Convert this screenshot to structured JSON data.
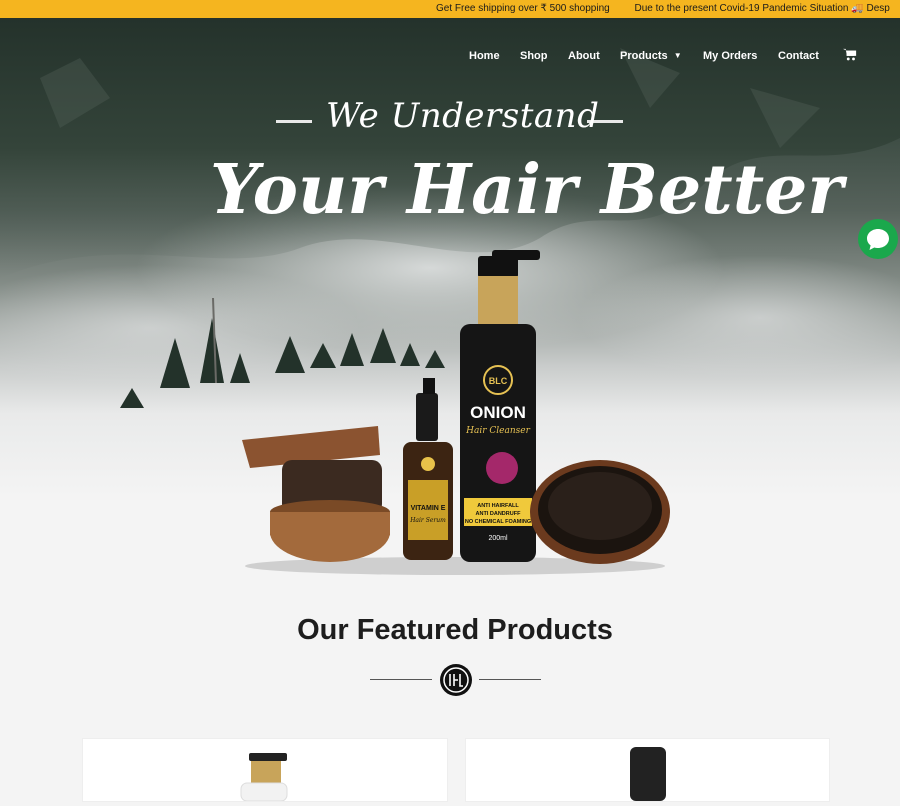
{
  "ticker": {
    "items": [
      "Get Free shipping over ₹ 500 shopping",
      "Due to the present Covid-19 Pandemic Situation 🚚 Desp"
    ]
  },
  "nav": {
    "items": [
      "Home",
      "Shop",
      "About",
      "Products",
      "My Orders",
      "Contact"
    ]
  },
  "hero": {
    "line1": "We Understand",
    "line2": "Your Hair Better",
    "products": {
      "brand": "BLC",
      "bottle_name": "ONION",
      "bottle_sub": "Hair Cleanser",
      "bottle_claims": [
        "ANTI HAIRFALL",
        "ANTI DANDRUFF",
        "NO CHEMICAL FOAMING"
      ],
      "bottle_volume": "200ml",
      "serum_name": "VITAMIN E",
      "serum_sub": "Hair Serum"
    }
  },
  "featured": {
    "title": "Our Featured Products"
  },
  "colors": {
    "accent": "#f5b51f",
    "chat": "#1aa84c"
  },
  "icons": {
    "cart": "cart-icon",
    "chat": "chat-bubble-icon"
  }
}
